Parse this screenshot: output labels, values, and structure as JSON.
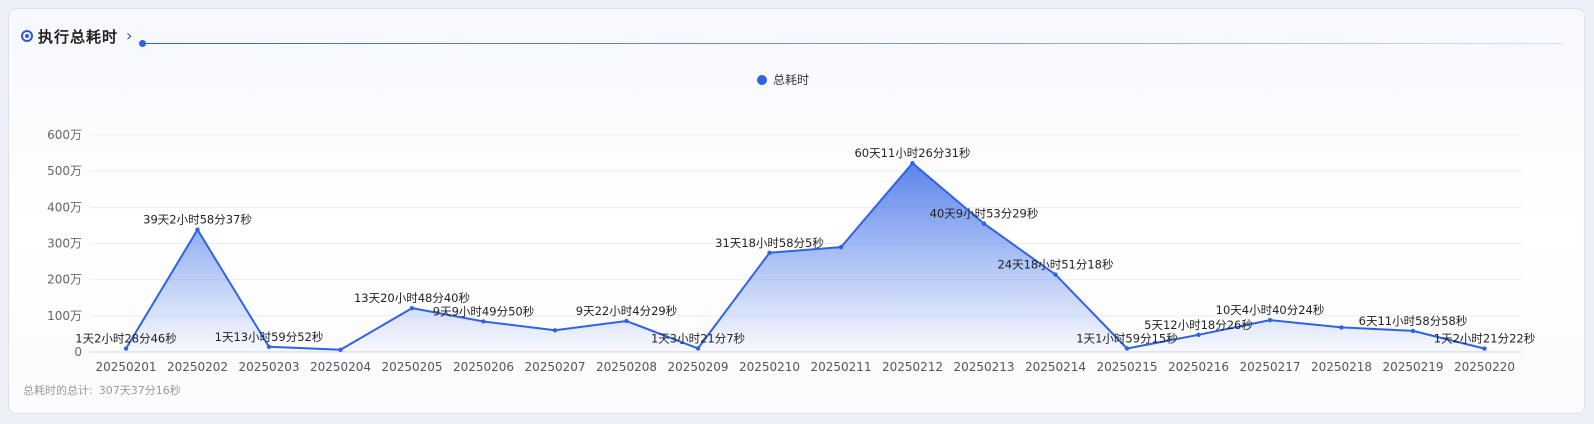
{
  "header": {
    "title": "执行总耗时",
    "icon": "target-icon",
    "chevron": "›"
  },
  "legend": {
    "label": "总耗时",
    "color": "#2f63e6"
  },
  "footer": {
    "label": "总耗时的总计:",
    "value": "307天37分16秒"
  },
  "chart_data": {
    "type": "area",
    "title": "执行总耗时",
    "xlabel": "",
    "ylabel": "",
    "ylim": [
      0,
      6000000
    ],
    "yticks": [
      "0",
      "100万",
      "200万",
      "300万",
      "400万",
      "500万",
      "600万"
    ],
    "grid": true,
    "legend_position": "top-center",
    "categories": [
      "20250201",
      "20250202",
      "20250203",
      "20250204",
      "20250205",
      "20250206",
      "20250207",
      "20250208",
      "20250209",
      "20250210",
      "20250211",
      "20250212",
      "20250213",
      "20250214",
      "20250215",
      "20250216",
      "20250217",
      "20250218",
      "20250219",
      "20250220"
    ],
    "series": [
      {
        "name": "总耗时",
        "values": [
          95326,
          3380317,
          143392,
          60000,
          1212520,
          844190,
          600000,
          857069,
          98467,
          2743085,
          2900000,
          5221591,
          3549209,
          2140278,
          97155,
          475706,
          880824,
          680000,
          583138,
          94882
        ],
        "labels": [
          "1天2小时28分46秒",
          "39天2小时58分37秒",
          "1天13小时59分52秒",
          "",
          "13天20小时48分40秒",
          "9天9小时49分50秒",
          "",
          "9天22小时4分29秒",
          "1天3小时21分7秒",
          "31天18小时58分5秒",
          "",
          "60天11小时26分31秒",
          "40天9小时53分29秒",
          "24天18小时51分18秒",
          "1天1小时59分15秒",
          "5天12小时18分26秒",
          "10天4小时40分24秒",
          "",
          "6天11小时58分58秒",
          "1天2小时21分22秒"
        ]
      }
    ]
  }
}
